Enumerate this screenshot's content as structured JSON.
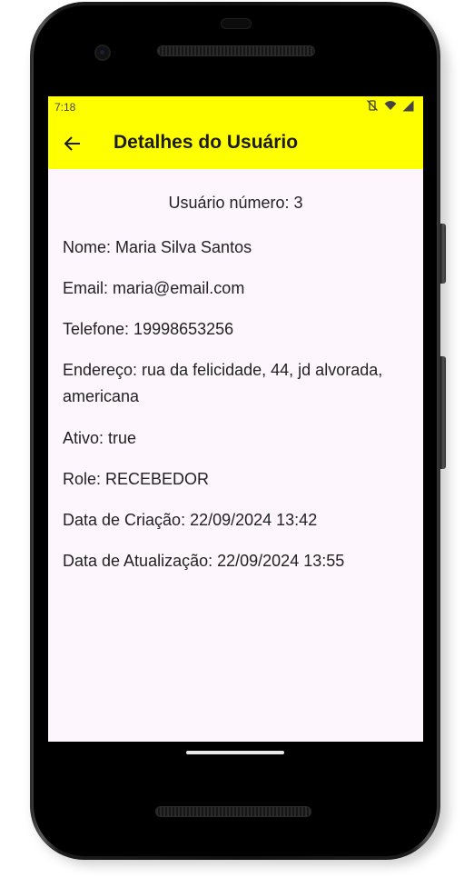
{
  "status_bar": {
    "time": "7:18",
    "icons": [
      "vibrate-off-icon",
      "wifi-icon",
      "signal-icon"
    ]
  },
  "app_bar": {
    "title": "Detalhes do Usuário",
    "back_icon": "arrow-left-icon",
    "background": "#ffff00"
  },
  "user": {
    "number_label": "Usuário número: 3",
    "fields": [
      "Nome: Maria Silva Santos",
      "Email: maria@email.com",
      "Telefone: 19998653256",
      "Endereço: rua da felicidade,  44, jd alvorada, americana",
      "Ativo: true",
      "Role: RECEBEDOR",
      "Data de Criação: 22/09/2024 13:42",
      "Data de Atualização: 22/09/2024 13:55"
    ]
  },
  "colors": {
    "screen_background": "#fdf7fd",
    "text": "#222222"
  }
}
